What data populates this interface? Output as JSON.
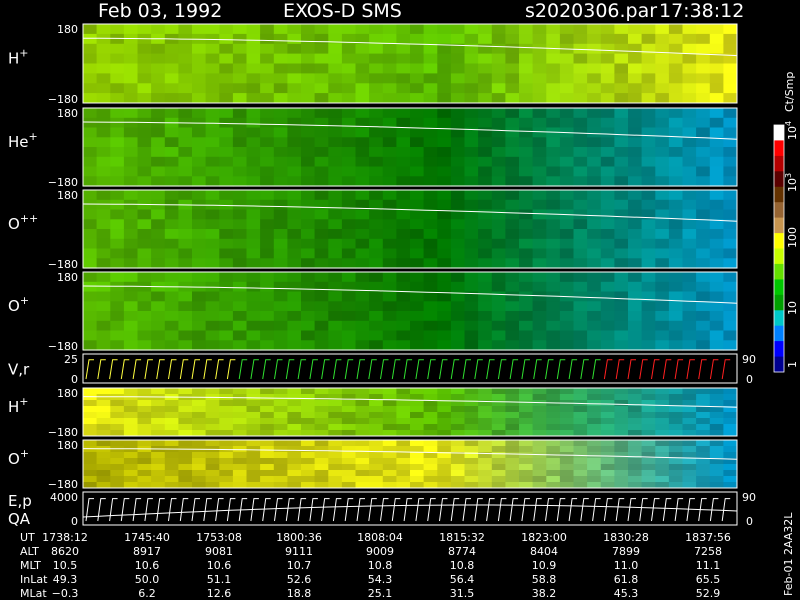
{
  "header": {
    "date": "Feb 03, 1992",
    "instrument": "EXOS-D SMS",
    "file": "s2020306.par",
    "time": "17:38:12"
  },
  "colors": {
    "background": "#000000",
    "trace": "#ffffff",
    "vr_series": [
      "#ffff40",
      "#30e030",
      "#ff2020"
    ]
  },
  "chart_data": {
    "type": "heatmap",
    "panels": [
      {
        "label_base": "H",
        "label_sup": "+",
        "y_top": "180",
        "y_bottom": "−180",
        "colormap_stops": [
          "yellow-green",
          "green",
          "yellow"
        ]
      },
      {
        "label_base": "He",
        "label_sup": "+",
        "y_top": "180",
        "y_bottom": "−180",
        "colormap_stops": [
          "green",
          "dark-green",
          "blue"
        ]
      },
      {
        "label_base": "O",
        "label_sup": "++",
        "y_top": "180",
        "y_bottom": "−180",
        "colormap_stops": [
          "green",
          "dark-green",
          "blue"
        ]
      },
      {
        "label_base": "O",
        "label_sup": "+",
        "y_top": "180",
        "y_bottom": "−180",
        "colormap_stops": [
          "green",
          "dark-green",
          "blue"
        ]
      },
      {
        "label": "V,r",
        "y_top": "25",
        "y_bottom": "0",
        "right_top": "90",
        "right_bottom": "0"
      },
      {
        "label_base": "H",
        "label_sup": "+",
        "y_top": "180",
        "y_bottom": "−180",
        "colormap_stops": [
          "yellow",
          "green",
          "blue"
        ]
      },
      {
        "label_base": "O",
        "label_sup": "+",
        "y_top": "180",
        "y_bottom": "−180",
        "colormap_stops": [
          "olive",
          "yellow",
          "blue"
        ]
      },
      {
        "label": "E,p",
        "label2": "QA",
        "y_top": "4000",
        "y_bottom": "0",
        "right_top": "90",
        "right_bottom": "0"
      }
    ],
    "colorbar": {
      "unit": "Ct/Smp",
      "tick_labels": [
        "1",
        "10",
        "100",
        "10",
        "10"
      ],
      "tick_sups": [
        "",
        "",
        "",
        "3",
        "4"
      ],
      "colors": [
        "#ffffff",
        "#ff0000",
        "#b40000",
        "#5a0000",
        "#643200",
        "#966432",
        "#c89650",
        "#ffff00",
        "#c8ff00",
        "#64e000",
        "#00c800",
        "#00a000",
        "#00c8c8",
        "#0080ff",
        "#0000ff",
        "#000090"
      ]
    },
    "table": {
      "rows": [
        {
          "label": "UT",
          "values": [
            "1738:12",
            "1745:40",
            "1753:08",
            "1800:36",
            "1808:04",
            "1815:32",
            "1823:00",
            "1830:28",
            "1837:56"
          ]
        },
        {
          "label": "ALT",
          "values": [
            "8620",
            "8917",
            "9081",
            "9111",
            "9009",
            "8774",
            "8404",
            "7899",
            "7258"
          ]
        },
        {
          "label": "MLT",
          "values": [
            "10.5",
            "10.6",
            "10.6",
            "10.7",
            "10.8",
            "10.8",
            "10.9",
            "11.0",
            "11.1"
          ]
        },
        {
          "label": "InLat",
          "values": [
            "49.3",
            "50.0",
            "51.1",
            "52.6",
            "54.3",
            "56.4",
            "58.8",
            "61.8",
            "65.5"
          ]
        },
        {
          "label": "MLat",
          "values": [
            "−0.3",
            "6.2",
            "12.6",
            "18.8",
            "25.1",
            "31.5",
            "38.2",
            "45.3",
            "52.9"
          ]
        }
      ]
    },
    "side_note": "Feb-01 2AA32L"
  }
}
